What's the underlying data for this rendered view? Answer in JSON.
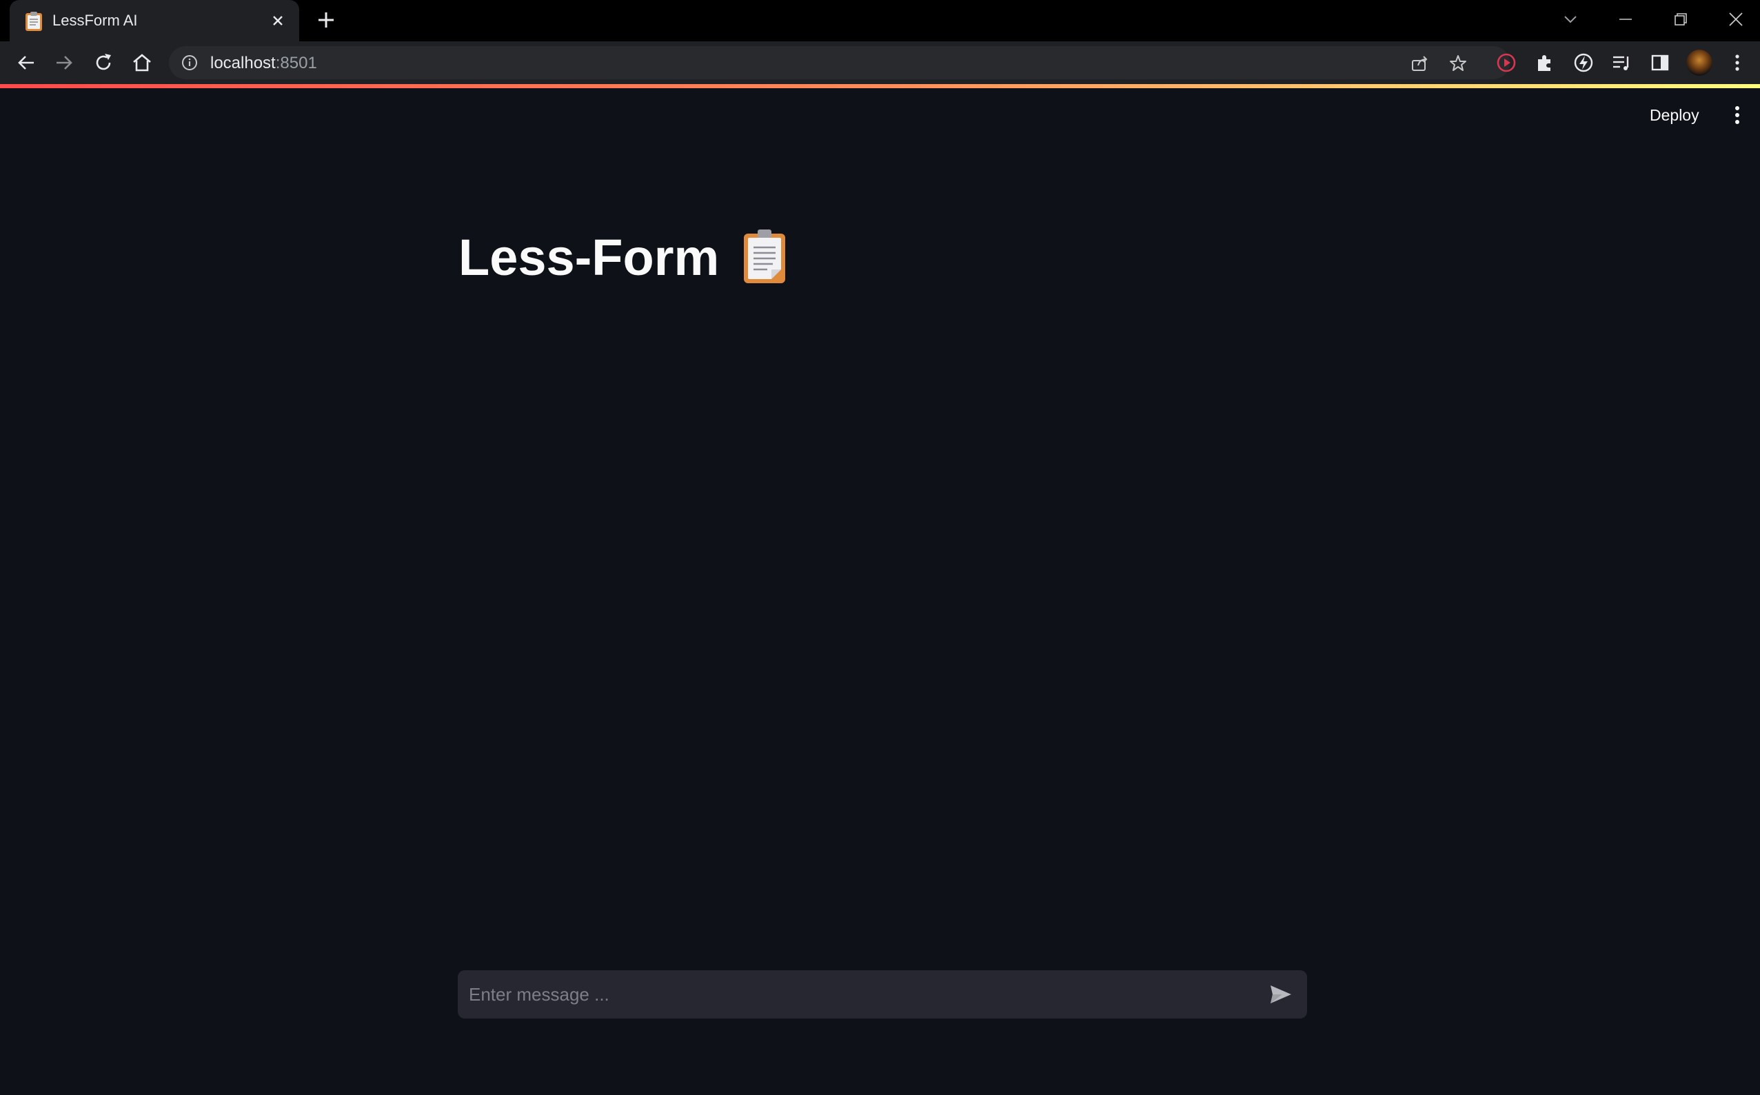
{
  "browser": {
    "tab": {
      "title": "LessForm AI",
      "favicon": "clipboard-icon"
    },
    "omnibox": {
      "host": "localhost",
      "port": ":8501"
    }
  },
  "app": {
    "header": {
      "deploy_label": "Deploy"
    },
    "title": "Less-Form",
    "title_emoji": "clipboard-icon",
    "chat": {
      "placeholder": "Enter message ..."
    }
  },
  "colors": {
    "background": "#0e1117",
    "chrome_dark": "#202124",
    "input_bg": "#262730",
    "text": "#fafafa"
  }
}
